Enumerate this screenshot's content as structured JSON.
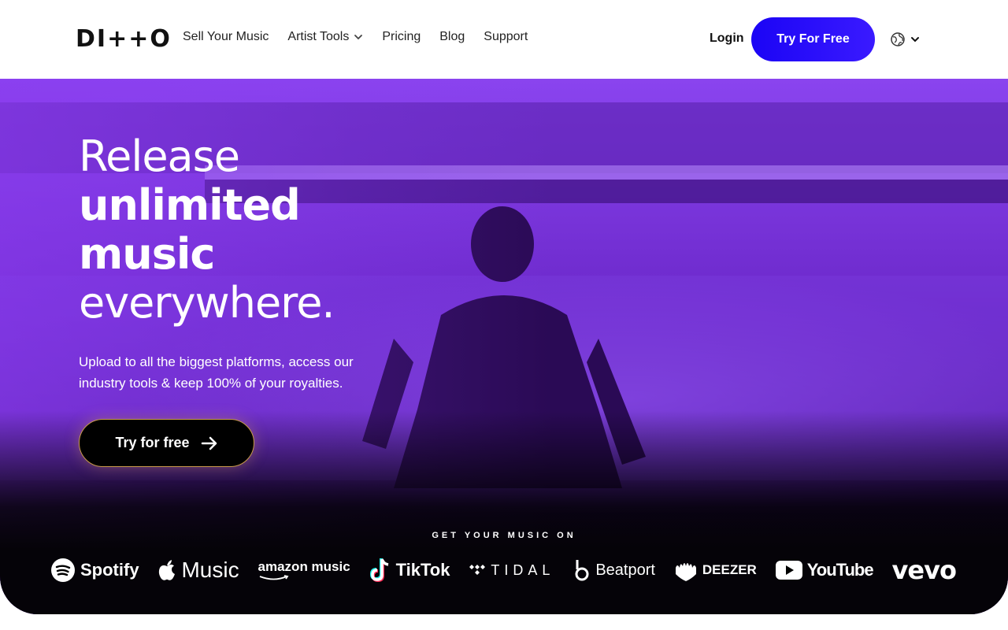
{
  "header": {
    "logo_text": "DI++O",
    "nav": [
      {
        "label": "Sell Your Music"
      },
      {
        "label": "Artist Tools",
        "has_dropdown": true
      },
      {
        "label": "Pricing"
      },
      {
        "label": "Blog"
      },
      {
        "label": "Support"
      }
    ],
    "login_label": "Login",
    "try_label": "Try For Free",
    "language_icon": "globe-icon"
  },
  "hero": {
    "headline_line1": "Release",
    "headline_line2": "unlimited",
    "headline_line3": "music",
    "headline_line4": "everywhere.",
    "subtext": "Upload to all the biggest platforms, access our industry tools & keep 100% of your royalties.",
    "cta_label": "Try for free",
    "platforms_heading": "GET YOUR MUSIC ON",
    "platforms": [
      "Spotify",
      "Music",
      "amazon music",
      "TikTok",
      "TIDAL",
      "Beatport",
      "DEEZER",
      "YouTube",
      "vevo"
    ]
  },
  "colors": {
    "accent": "#2d0fff",
    "hero_purple": "#7a2fe0"
  }
}
